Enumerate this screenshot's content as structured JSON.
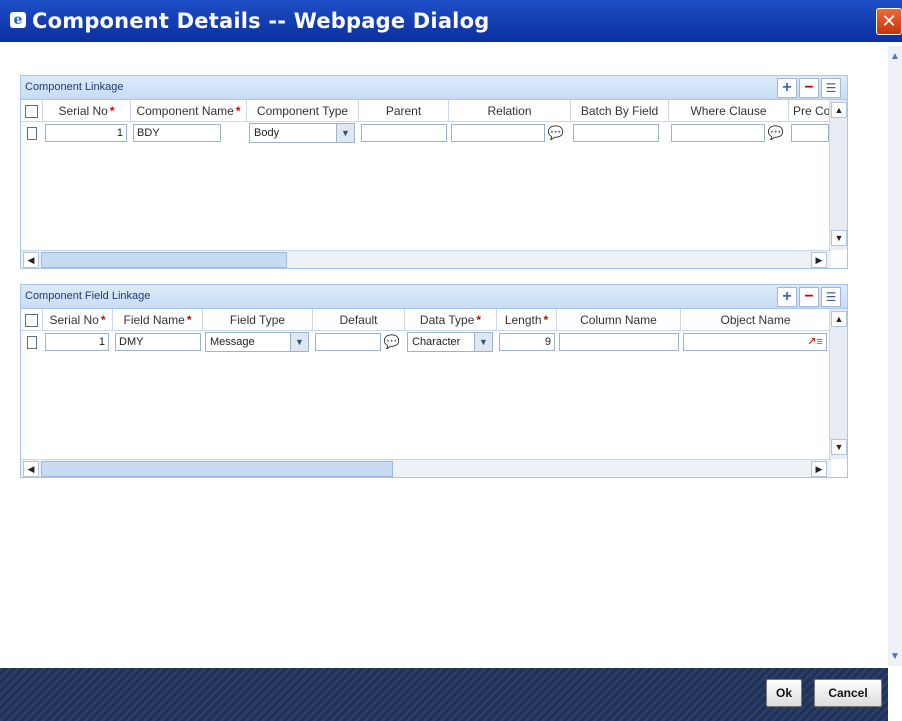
{
  "window": {
    "title": "Component Details -- Webpage Dialog"
  },
  "component_linkage": {
    "title": "Component Linkage",
    "columns": [
      "Serial No",
      "Component Name",
      "Component Type",
      "Parent",
      "Relation",
      "Batch By Field",
      "Where Clause",
      "Pre Co"
    ],
    "required": [
      true,
      true,
      false,
      false,
      false,
      false,
      false,
      false
    ],
    "rows": [
      {
        "serial_no": "1",
        "component_name": "BDY",
        "component_type": "Body",
        "parent": "",
        "relation": "",
        "batch_by_field": "",
        "where_clause": ""
      }
    ]
  },
  "component_field_linkage": {
    "title": "Component Field Linkage",
    "columns": [
      "Serial No",
      "Field Name",
      "Field Type",
      "Default",
      "Data Type",
      "Length",
      "Column Name",
      "Object Name"
    ],
    "required": [
      true,
      true,
      false,
      false,
      true,
      true,
      false,
      false
    ],
    "rows": [
      {
        "serial_no": "1",
        "field_name": "DMY",
        "field_type": "Message",
        "default": "",
        "data_type": "Character",
        "length": "9",
        "column_name": "",
        "object_name": ""
      }
    ]
  },
  "buttons": {
    "ok": "Ok",
    "cancel": "Cancel"
  },
  "icons": {
    "add": "plus-icon",
    "delete": "minus-icon",
    "view": "list-view-icon",
    "lookup": "speech-bubble-lookup-icon",
    "object": "object-lookup-icon"
  },
  "colors": {
    "titlebar": "#1646b8",
    "panel_header": "#cfe1f6",
    "footer": "#243759",
    "required": "#d40000"
  }
}
